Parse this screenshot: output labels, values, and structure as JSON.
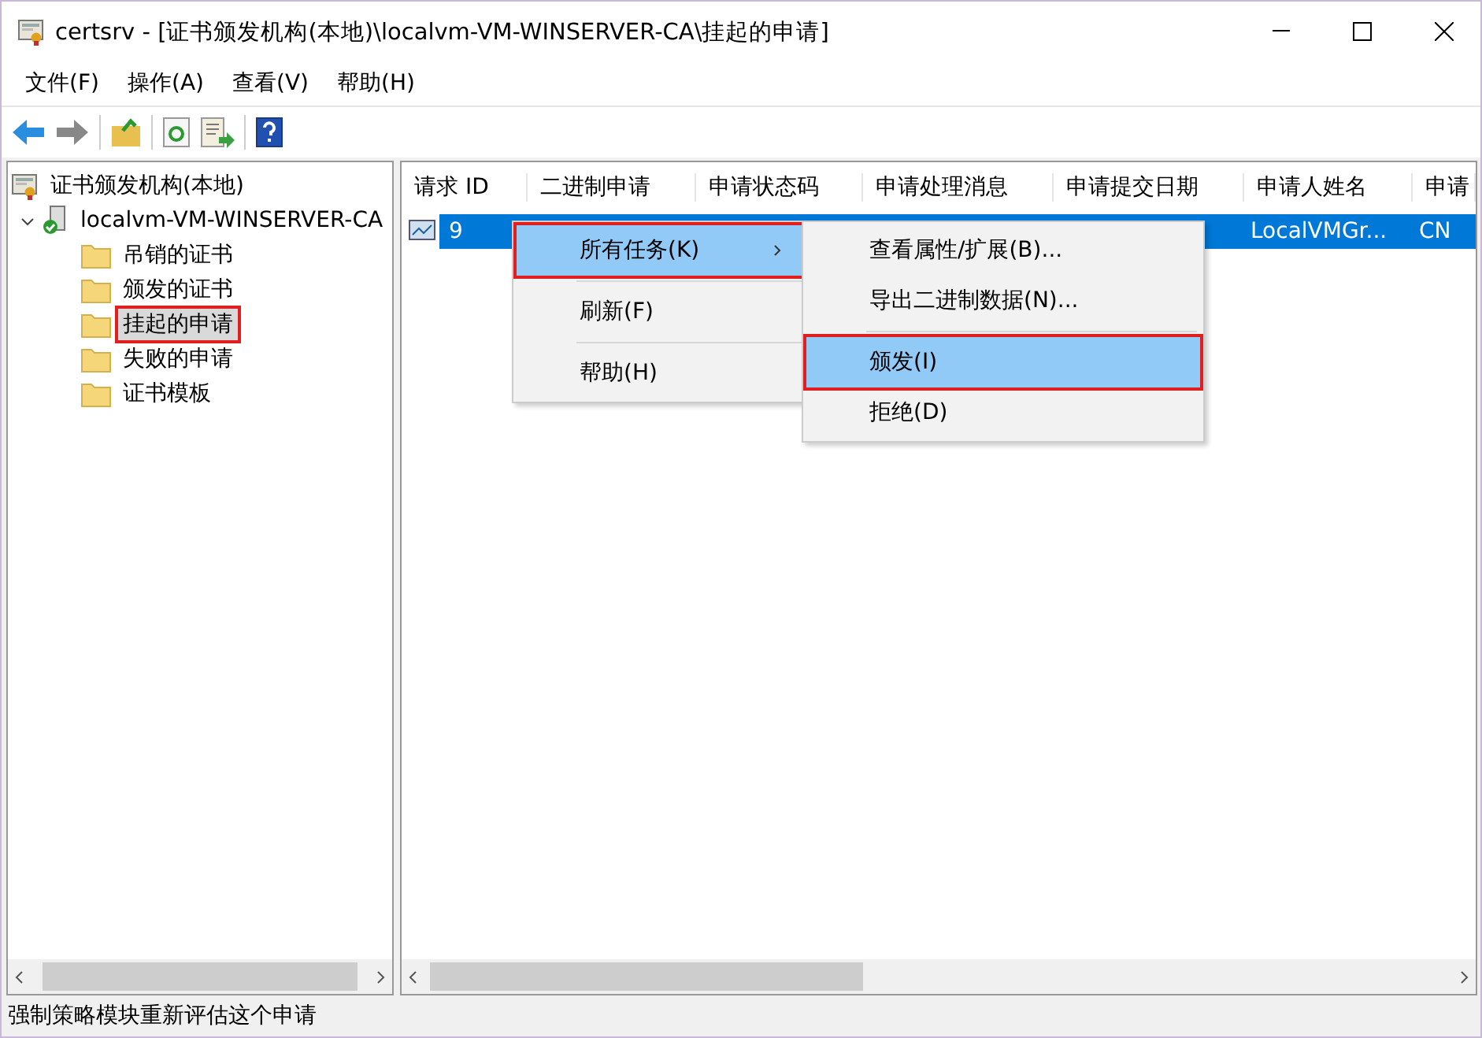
{
  "window": {
    "title": "certsrv - [证书颁发机构(本地)\\localvm-VM-WINSERVER-CA\\挂起的申请]"
  },
  "menu_bar": [
    "文件(F)",
    "操作(A)",
    "查看(V)",
    "帮助(H)"
  ],
  "tree": {
    "label": "证书颁发机构(本地)",
    "children": [
      {
        "label": "localvm-VM-WINSERVER-CA",
        "expanded": true,
        "children": [
          {
            "label": "吊销的证书",
            "selected": false,
            "annotated": false
          },
          {
            "label": "颁发的证书",
            "selected": false,
            "annotated": false
          },
          {
            "label": "挂起的申请",
            "selected": true,
            "annotated": true
          },
          {
            "label": "失败的申请",
            "selected": false,
            "annotated": false
          },
          {
            "label": "证书模板",
            "selected": false,
            "annotated": false
          }
        ]
      }
    ]
  },
  "table": {
    "columns": [
      "请求 ID",
      "二进制申请",
      "申请状态码",
      "申请处理消息",
      "申请提交日期",
      "申请人姓名",
      "申请"
    ],
    "rows": [
      {
        "selected": true,
        "cells": [
          "9",
          "",
          "",
          "",
          "",
          "LocalVMGr...",
          "CN"
        ]
      }
    ]
  },
  "context_menu": {
    "items": [
      {
        "label": "所有任务(K)",
        "kind": "submenu",
        "selected": true,
        "annotated": true
      },
      {
        "kind": "separator"
      },
      {
        "label": "刷新(F)",
        "kind": "item",
        "selected": false,
        "annotated": false
      },
      {
        "kind": "separator"
      },
      {
        "label": "帮助(H)",
        "kind": "item",
        "selected": false,
        "annotated": false
      }
    ]
  },
  "submenu": {
    "items": [
      {
        "label": "查看属性/扩展(B)...",
        "kind": "item",
        "selected": false,
        "annotated": false
      },
      {
        "label": "导出二进制数据(N)...",
        "kind": "item",
        "selected": false,
        "annotated": false
      },
      {
        "kind": "separator"
      },
      {
        "label": "颁发(I)",
        "kind": "item",
        "selected": true,
        "annotated": true
      },
      {
        "label": "拒绝(D)",
        "kind": "item",
        "selected": false,
        "annotated": false
      }
    ]
  },
  "status_bar": "强制策略模块重新评估这个申请"
}
